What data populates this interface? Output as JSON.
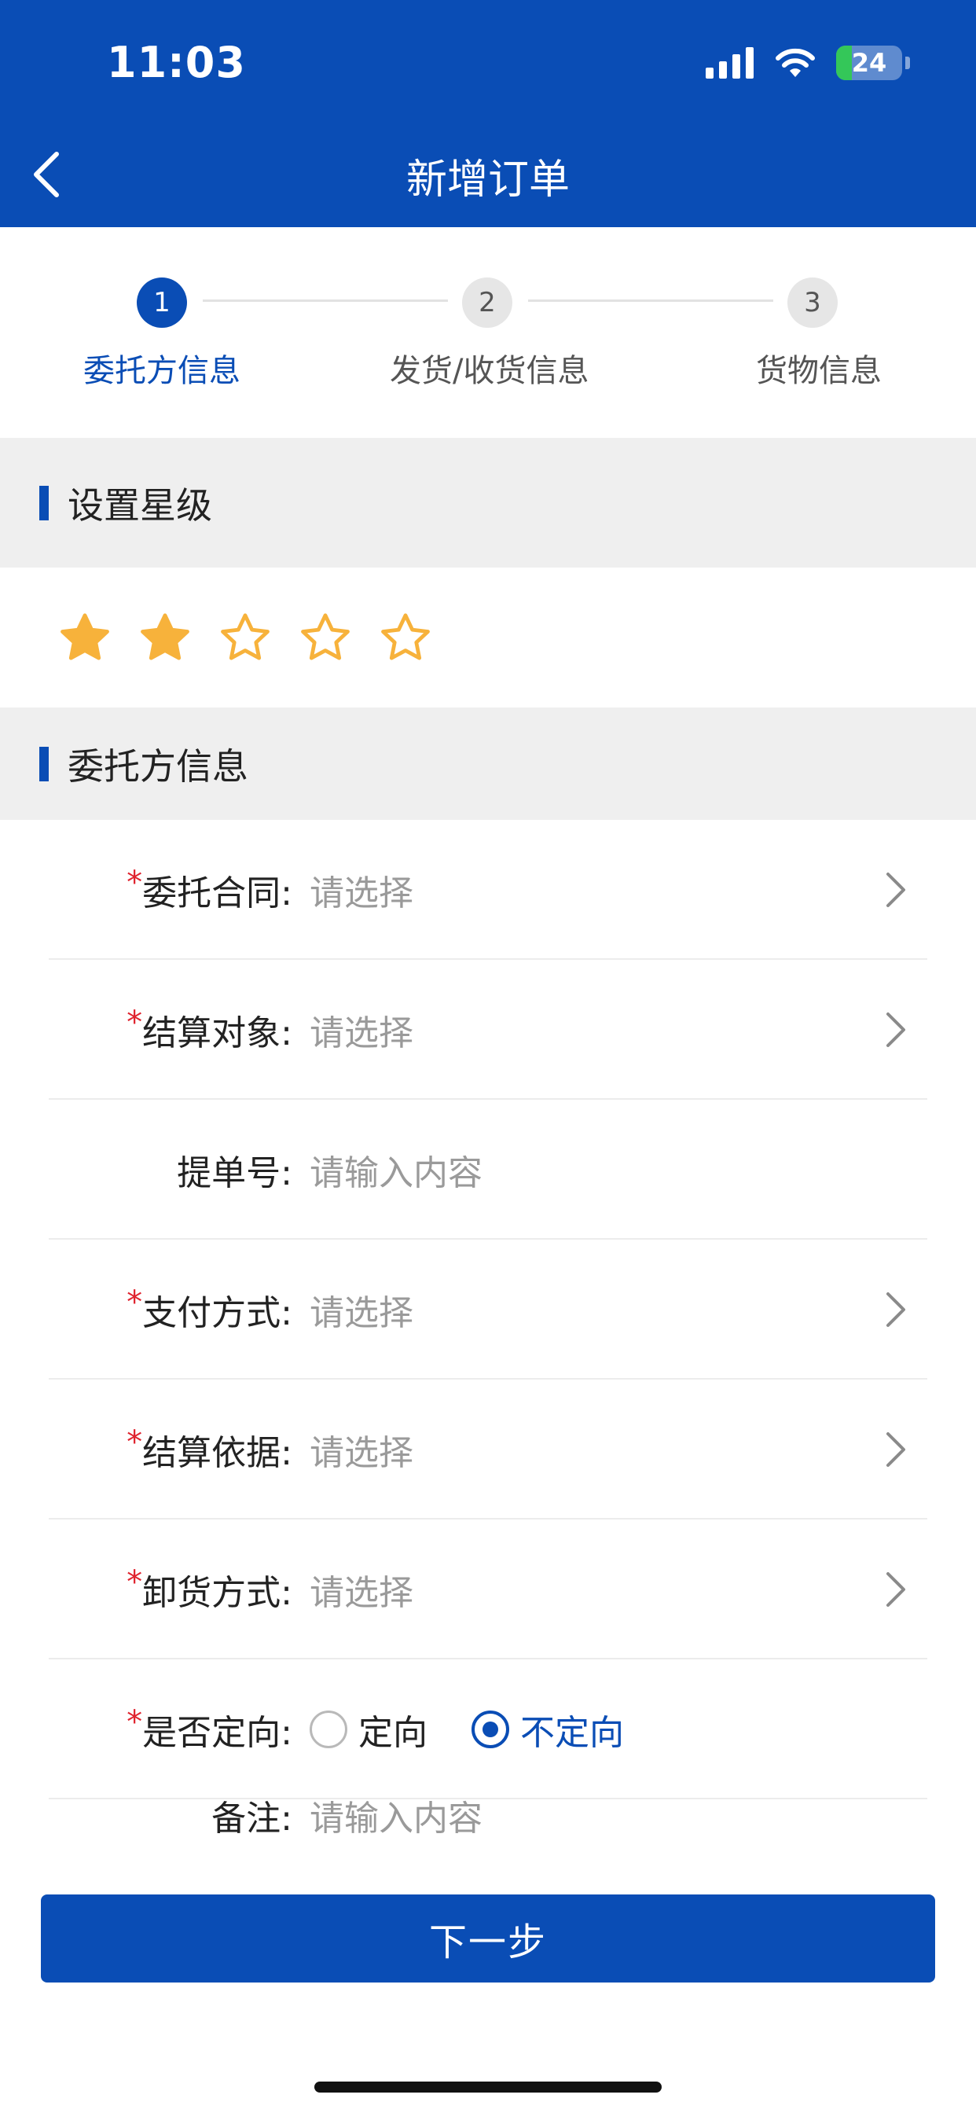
{
  "status_bar": {
    "time": "11:03",
    "battery": "24"
  },
  "nav": {
    "title": "新增订单"
  },
  "steps": [
    {
      "num": "1",
      "label": "委托方信息",
      "active": true
    },
    {
      "num": "2",
      "label": "发货/收货信息",
      "active": false
    },
    {
      "num": "3",
      "label": "货物信息",
      "active": false
    }
  ],
  "rating_section": {
    "title": "设置星级"
  },
  "rating": {
    "value": 2,
    "max": 5,
    "color": "#f7b23b"
  },
  "client_section": {
    "title": "委托方信息"
  },
  "form": {
    "contract": {
      "required": "*",
      "label": "委托合同:",
      "placeholder": "请选择"
    },
    "settle_target": {
      "required": "*",
      "label": "结算对象:",
      "placeholder": "请选择"
    },
    "bill_no": {
      "label": "提单号:",
      "placeholder": "请输入内容"
    },
    "payment": {
      "required": "*",
      "label": "支付方式:",
      "placeholder": "请选择"
    },
    "settle_basis": {
      "required": "*",
      "label": "结算依据:",
      "placeholder": "请选择"
    },
    "unload": {
      "required": "*",
      "label": "卸货方式:",
      "placeholder": "请选择"
    },
    "directed": {
      "required": "*",
      "label": "是否定向:",
      "options": [
        "定向",
        "不定向"
      ],
      "selected": "不定向"
    },
    "remark": {
      "label": "备注:",
      "placeholder": "请输入内容"
    }
  },
  "footer": {
    "next_label": "下一步"
  },
  "colors": {
    "primary": "#0a4db5",
    "required": "#e0242f",
    "star": "#f7b23b"
  }
}
